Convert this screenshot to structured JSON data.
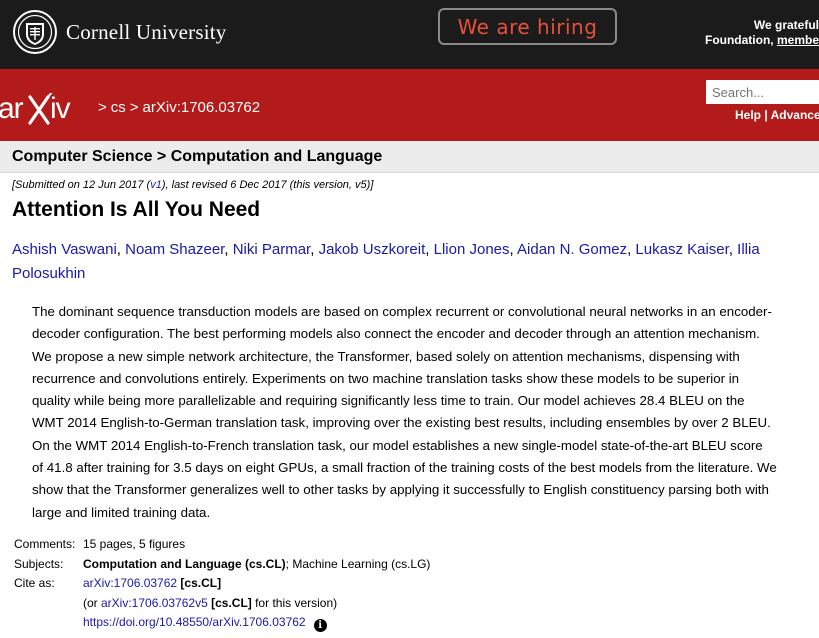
{
  "topbar": {
    "university_name": "Cornell University",
    "hiring_label": "We are hiring",
    "grateful_line1": "We grateful",
    "grateful_line2_prefix": "Foundation, ",
    "grateful_line2_link": "membe"
  },
  "header": {
    "logo_text": "arXiv",
    "breadcrumb_sep1": ">",
    "breadcrumb_cs": "cs",
    "breadcrumb_sep2": ">",
    "breadcrumb_id": "arXiv:1706.03762",
    "search_placeholder": "Search...",
    "help_label": "Help",
    "help_sep": " | ",
    "advanced_label": "Advanced"
  },
  "subheader": {
    "title": "Computer Science > Computation and Language"
  },
  "paper": {
    "dateline_prefix": "[Submitted on 12 Jun 2017 (",
    "dateline_v1": "v1",
    "dateline_suffix": "), last revised 6 Dec 2017 (this version, v5)]",
    "title": "Attention Is All You Need",
    "authors": [
      "Ashish Vaswani",
      "Noam Shazeer",
      "Niki Parmar",
      "Jakob Uszkoreit",
      "Llion Jones",
      "Aidan N. Gomez",
      "Lukasz Kaiser",
      "Illia Polosukhin"
    ],
    "abstract": "The dominant sequence transduction models are based on complex recurrent or convolutional neural networks in an encoder-decoder configuration. The best performing models also connect the encoder and decoder through an attention mechanism. We propose a new simple network architecture, the Transformer, based solely on attention mechanisms, dispensing with recurrence and convolutions entirely. Experiments on two machine translation tasks show these models to be superior in quality while being more parallelizable and requiring significantly less time to train. Our model achieves 28.4 BLEU on the WMT 2014 English-to-German translation task, improving over the existing best results, including ensembles by over 2 BLEU. On the WMT 2014 English-to-French translation task, our model establishes a new single-model state-of-the-art BLEU score of 41.8 after training for 3.5 days on eight GPUs, a small fraction of the training costs of the best models from the literature. We show that the Transformer generalizes well to other tasks by applying it successfully to English constituency parsing both with large and limited training data."
  },
  "meta": {
    "comments_label": "Comments:",
    "comments_value": "15 pages, 5 figures",
    "subjects_label": "Subjects:",
    "subjects_primary": "Computation and Language (cs.CL)",
    "subjects_secondary": "; Machine Learning (cs.LG)",
    "cite_label": "Cite as:",
    "cite_id": "arXiv:1706.03762",
    "cite_tag": "[cs.CL]",
    "cite2_prefix": "(or ",
    "cite2_id": "arXiv:1706.03762v5",
    "cite2_tag": "[cs.CL]",
    "cite2_suffix": " for this version)",
    "doi": "https://doi.org/10.48550/arXiv.1706.03762",
    "info_icon_glyph": "i"
  },
  "colors": {
    "topbar_bg": "#1b1b1b",
    "arxiv_red": "#b31b1b",
    "link_blue": "#1a1aa6",
    "hiring_text": "#e8503a"
  }
}
